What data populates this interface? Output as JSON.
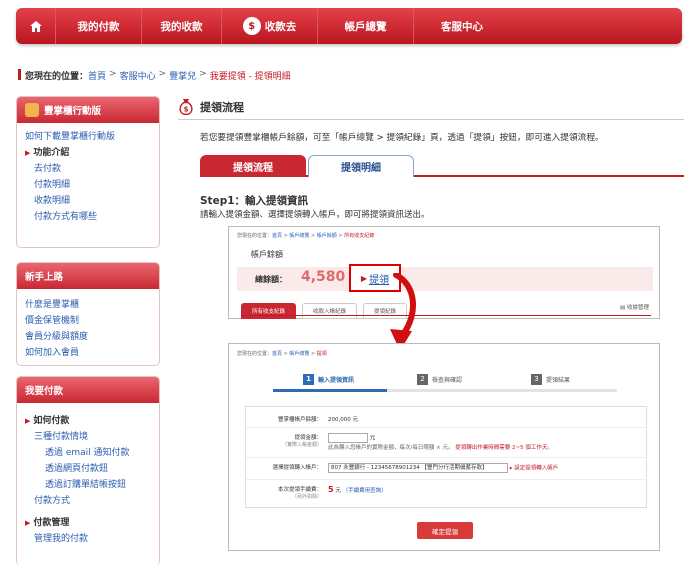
{
  "nav": {
    "items": [
      "我的付款",
      "我的收款",
      "收款去",
      "帳戶總覽",
      "客服中心"
    ],
    "coin_glyph": "$"
  },
  "breadcrumb": {
    "label": "您現在的位置：",
    "items": [
      "首頁",
      "客服中心",
      "豐掌兒",
      "我要提領 - 提領明細"
    ]
  },
  "sidebar": {
    "box1": {
      "title": "豐掌櫃行動版",
      "items": [
        "如何下載豐掌櫃行動版",
        "功能介紹",
        "去付款",
        "付款明細",
        "收款明細",
        "付款方式有哪些"
      ]
    },
    "box2": {
      "title": "新手上路",
      "items": [
        "什麼是豐掌櫃",
        "價金保管機制",
        "會員分級與額度",
        "如何加入會員"
      ]
    },
    "box3": {
      "title": "我要付款",
      "items": [
        "如何付款",
        "三種付款情境",
        "透過 email 通知付款",
        "透過網頁付款鈕",
        "透過訂購單結帳按鈕",
        "付款方式",
        "付款管理",
        "管理我的付款"
      ]
    }
  },
  "main": {
    "title": "提領流程",
    "intro": "若您要提領豐掌櫃帳戶餘額，可至「帳戶總覽 > 提領紀錄」頁，透過「提領」按鈕，即可進入提領流程。",
    "tabs": [
      "提領流程",
      "提領明細"
    ],
    "step_title": "Step1：輸入提領資訊",
    "step_desc": "請輸入提領金額、選擇提領轉入帳戶，即可將提領資訊送出。"
  },
  "img1": {
    "crumb_prefix": "您現在的位置：",
    "crumb_items": [
      "首頁",
      "帳戶總覽",
      "帳戶餘額",
      "所有收支紀錄"
    ],
    "section_title": "帳戶餘額",
    "balance_label": "總餘額：",
    "balance_value": "4,580",
    "withdraw_link": "提領",
    "tabs": [
      "所有收支紀錄",
      "收款入帳紀錄",
      "提領紀錄"
    ],
    "manage": "收據管理"
  },
  "img2": {
    "crumb_prefix": "您現在的位置：",
    "crumb_items": [
      "首頁",
      "帳戶總覽",
      "提領"
    ],
    "steps": [
      {
        "num": "1",
        "label": "輸入提領資訊"
      },
      {
        "num": "2",
        "label": "檢查與確認"
      },
      {
        "num": "3",
        "label": "提領結果"
      }
    ],
    "progress_fraction": 0.33,
    "rows": {
      "balance_key": "豐掌櫃帳戶餘額：",
      "balance_val": "200,000 元",
      "amount_key": "提領金額：",
      "amount_sub": "（實際入帳金額）",
      "amount_unit": "元",
      "amount_note": "此為轉入您帳戶的實際金額，每次/每日限額 × 元。",
      "amount_note_red": "提領轉出作業時間需要 2~5 個工作天。",
      "account_key": "選擇提領轉入帳戶：",
      "account_val": "807 永豐銀行 - 12345678901234 【豐門分行活期儲蓄存款】",
      "account_link": "設定提領轉入帳戶",
      "fee_key": "本次提領手續費：",
      "fee_sub": "（另外扣除）",
      "fee_num": "5",
      "fee_unit": "元",
      "fee_note": "（手續費用查詢）"
    },
    "confirm_button": "確定提領"
  },
  "colors": {
    "brand_red": "#c21b24",
    "link_blue": "#2a5db0",
    "step_blue": "#2e6cb5"
  }
}
